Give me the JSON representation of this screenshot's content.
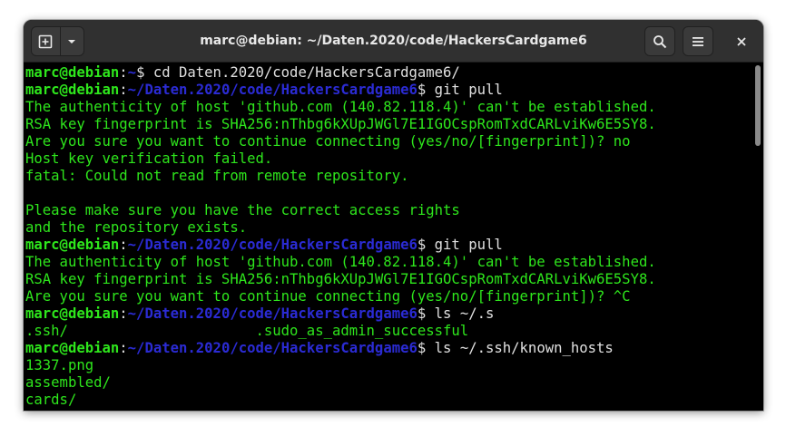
{
  "window": {
    "title": "marc@debian: ~/Daten.2020/code/HackersCardgame6"
  },
  "header": {
    "new_tab_icon": "new-tab-icon",
    "dropdown_icon": "chevron-down-icon",
    "search_icon": "search-icon",
    "menu_icon": "hamburger-menu-icon",
    "close_icon": "close-icon"
  },
  "colors": {
    "prompt_user": "#2ee61c",
    "prompt_path": "#2b2bd4",
    "text": "#e0e0e0",
    "output": "#2ee61c",
    "background": "#000000",
    "titlebar": "#303030"
  },
  "terminal": {
    "lines": [
      {
        "type": "prompt",
        "user": "marc@debian",
        "sep": ":",
        "path": "~",
        "dollar": "$",
        "cmd": " cd Daten.2020/code/HackersCardgame6/"
      },
      {
        "type": "prompt",
        "user": "marc@debian",
        "sep": ":",
        "path": "~/Daten.2020/code/HackersCardgame6",
        "dollar": "$",
        "cmd": " git pull"
      },
      {
        "type": "output",
        "text": "The authenticity of host 'github.com (140.82.118.4)' can't be established."
      },
      {
        "type": "output",
        "text": "RSA key fingerprint is SHA256:nThbg6kXUpJWGl7E1IGOCspRomTxdCARLviKw6E5SY8."
      },
      {
        "type": "output",
        "text": "Are you sure you want to continue connecting (yes/no/[fingerprint])? no"
      },
      {
        "type": "output",
        "text": "Host key verification failed."
      },
      {
        "type": "output",
        "text": "fatal: Could not read from remote repository."
      },
      {
        "type": "output",
        "text": ""
      },
      {
        "type": "output",
        "text": "Please make sure you have the correct access rights"
      },
      {
        "type": "output",
        "text": "and the repository exists."
      },
      {
        "type": "prompt",
        "user": "marc@debian",
        "sep": ":",
        "path": "~/Daten.2020/code/HackersCardgame6",
        "dollar": "$",
        "cmd": " git pull"
      },
      {
        "type": "output",
        "text": "The authenticity of host 'github.com (140.82.118.4)' can't be established."
      },
      {
        "type": "output",
        "text": "RSA key fingerprint is SHA256:nThbg6kXUpJWGl7E1IGOCspRomTxdCARLviKw6E5SY8."
      },
      {
        "type": "output",
        "text": "Are you sure you want to continue connecting (yes/no/[fingerprint])? ^C"
      },
      {
        "type": "prompt",
        "user": "marc@debian",
        "sep": ":",
        "path": "~/Daten.2020/code/HackersCardgame6",
        "dollar": "$",
        "cmd": " ls ~/.s"
      },
      {
        "type": "output",
        "text": ".ssh/                      .sudo_as_admin_successful"
      },
      {
        "type": "prompt",
        "user": "marc@debian",
        "sep": ":",
        "path": "~/Daten.2020/code/HackersCardgame6",
        "dollar": "$",
        "cmd": " ls ~/.ssh/known_hosts"
      },
      {
        "type": "output",
        "text": "1337.png"
      },
      {
        "type": "output",
        "text": "assembled/"
      },
      {
        "type": "output",
        "text": "cards/"
      }
    ]
  }
}
